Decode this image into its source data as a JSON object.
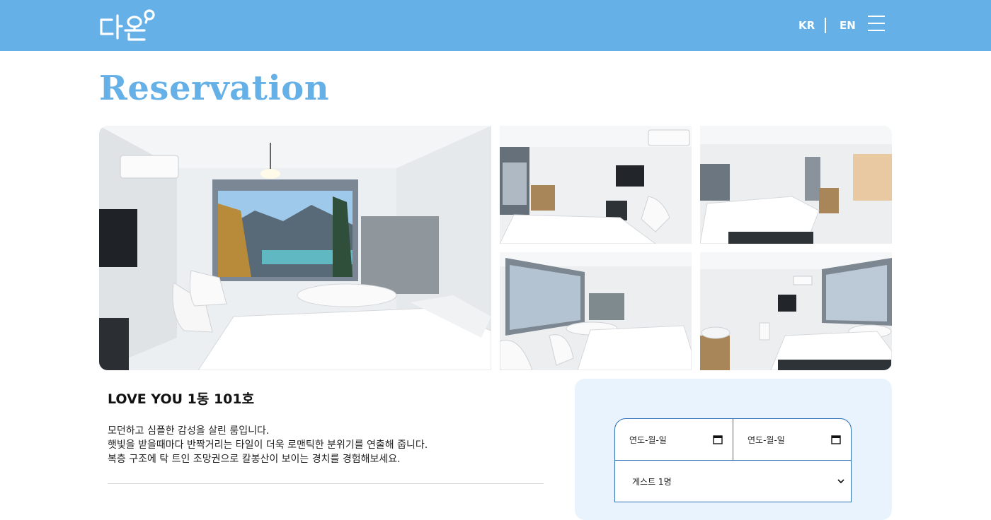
{
  "header": {
    "logo_text": "다온",
    "lang_kr": "KR",
    "lang_en": "EN",
    "menu_icon": "hamburger-menu-icon",
    "background": "#65b0e6"
  },
  "page": {
    "title": "Reservation"
  },
  "gallery": {
    "photos": [
      "bedroom-lake-view-photo",
      "bedroom-tv-chairs-photo",
      "bedroom-kitchen-photo",
      "bedroom-window-bathtub-photo",
      "bedroom-sink-window-photo"
    ]
  },
  "room": {
    "name": "LOVE YOU 1동 101호",
    "description": [
      "모던하고 심플한 감성을 살린 룸입니다.",
      "햇빛을 받을때마다 반짝거리는 타일이 더욱 로맨틱한 분위기를 연출해 줍니다.",
      "복층 구조에 탁 트인 조망권으로 칼봉산이 보이는 경치를 경험해보세요."
    ]
  },
  "booking": {
    "checkin_placeholder": "연도-월-일",
    "checkout_placeholder": "연도-월-일",
    "guests_selected": "게스트 1명",
    "accent": "#2f6fb8",
    "panel_background": "#e8f3fd"
  }
}
